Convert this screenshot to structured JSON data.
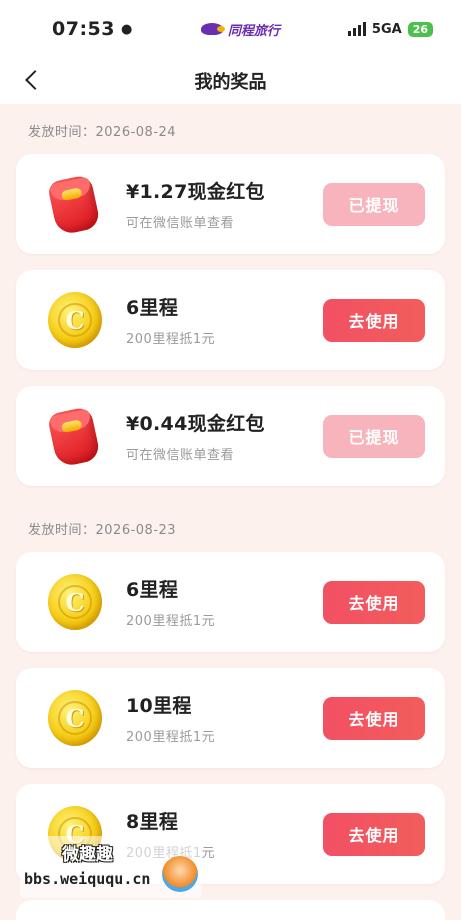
{
  "status_bar": {
    "time": "07:53",
    "brand_name": "同程旅行",
    "network": "5GA",
    "battery": "26"
  },
  "header": {
    "title": "我的奖品"
  },
  "sections": [
    {
      "date_label": "发放时间：2026-08-24",
      "items": [
        {
          "icon": "red-packet-icon",
          "name": "¥1.27现金红包",
          "desc": "可在微信账单查看",
          "button": "已提现",
          "button_state": "done"
        },
        {
          "icon": "coin-icon",
          "name": "6里程",
          "desc": "200里程抵1元",
          "button": "去使用",
          "button_state": "active"
        },
        {
          "icon": "red-packet-icon",
          "name": "¥0.44现金红包",
          "desc": "可在微信账单查看",
          "button": "已提现",
          "button_state": "done"
        }
      ]
    },
    {
      "date_label": "发放时间：2026-08-23",
      "items": [
        {
          "icon": "coin-icon",
          "name": "6里程",
          "desc": "200里程抵1元",
          "button": "去使用",
          "button_state": "active"
        },
        {
          "icon": "coin-icon",
          "name": "10里程",
          "desc": "200里程抵1元",
          "button": "去使用",
          "button_state": "active"
        },
        {
          "icon": "coin-icon",
          "name": "8里程",
          "desc": "200里程抵1元",
          "button": "去使用",
          "button_state": "active"
        }
      ]
    }
  ],
  "watermark": {
    "title": "微趣趣",
    "url": "bbs.weiququ.cn"
  },
  "colors": {
    "accent": "#f25064",
    "accent_disabled": "#f8b4bc",
    "background": "#fdf1ee"
  }
}
